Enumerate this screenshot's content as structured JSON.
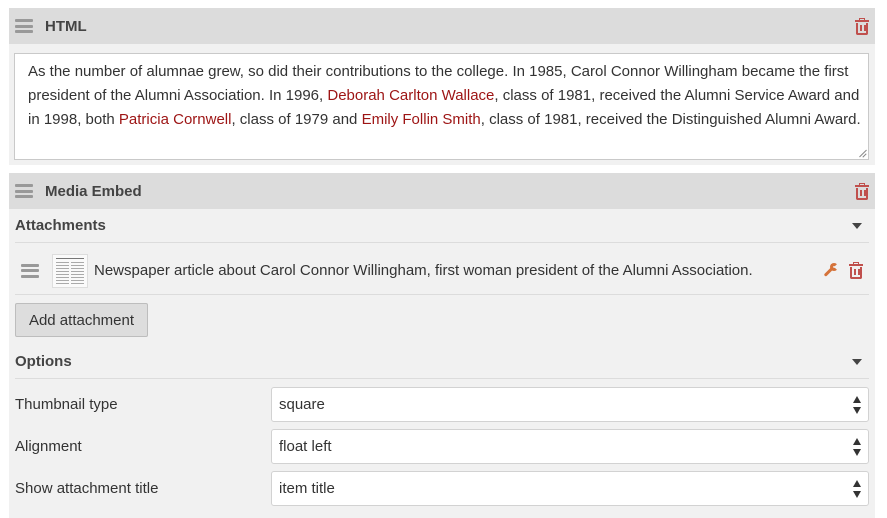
{
  "html_block": {
    "title": "HTML",
    "content": {
      "p1": "As the number of alumnae grew, so did their contributions to the college. In 1985, Carol Connor Willingham became the first president of the Alumni Association. In 1996, ",
      "link1": "Deborah Carlton Wallace",
      "p2": ", class of 1981, received the Alumni Service Award and in 1998, both ",
      "link2": "Patricia Cornwell",
      "p3": ", class of 1979 and ",
      "link3": "Emily Follin Smith",
      "p4": ", class of 1981, received the Distinguished Alumni Award."
    }
  },
  "media_block": {
    "title": "Media Embed",
    "attachments": {
      "label": "Attachments",
      "items": [
        {
          "caption": "Newspaper article about Carol Connor Willingham, first woman president of the Alumni Association."
        }
      ],
      "add_label": "Add attachment"
    },
    "options": {
      "label": "Options",
      "thumbnail_type": {
        "label": "Thumbnail type",
        "value": "square"
      },
      "alignment": {
        "label": "Alignment",
        "value": "float left"
      },
      "show_title": {
        "label": "Show attachment title",
        "value": "item title"
      }
    }
  },
  "colors": {
    "link": "#9d1414",
    "delete": "#c0504d",
    "wrench": "#d5733a",
    "header_bg": "#dcdcdc",
    "panel_bg": "#f1f1f1"
  },
  "icons": [
    "drag-handle-icon",
    "trash-icon",
    "wrench-icon",
    "caret-down-icon",
    "select-arrows-icon",
    "resize-handle-icon"
  ]
}
